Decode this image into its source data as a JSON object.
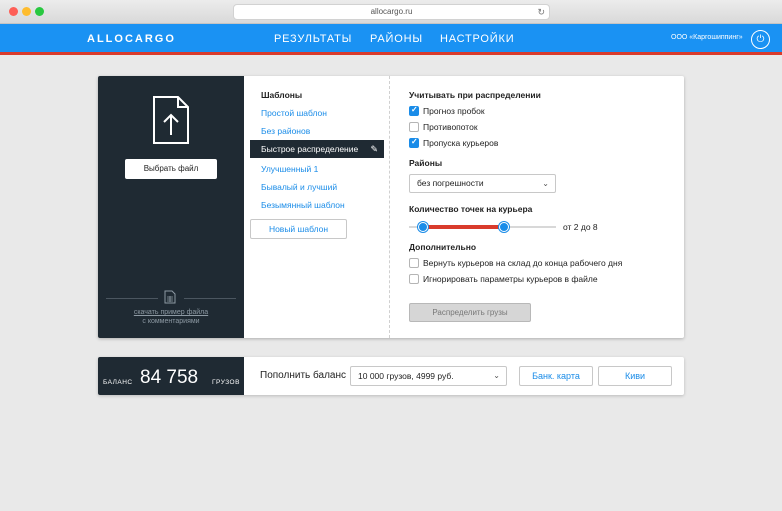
{
  "browser": {
    "url": "allocargo.ru"
  },
  "header": {
    "logo": "ALLOCARGO",
    "nav": [
      "РЕЗУЛЬТАТЫ",
      "РАЙОНЫ",
      "НАСТРОЙКИ"
    ],
    "company": "ООО «Каргошиппинг»"
  },
  "upload": {
    "choose_button": "Выбрать файл",
    "sample_link": "скачать пример файла",
    "sample_sub": "с комментариями"
  },
  "templates": {
    "title": "Шаблоны",
    "items": [
      "Простой шаблон",
      "Без районов",
      "Быстрое распределение",
      "Улучшенный 1",
      "Бывалый и лучший",
      "Безымянный шаблон"
    ],
    "active": "Быстрое распределение",
    "new_button": "Новый шаблон"
  },
  "settings": {
    "consider_title": "Учитывать при распределении",
    "consider": [
      {
        "label": "Прогноз пробок",
        "checked": true
      },
      {
        "label": "Противопоток",
        "checked": false
      },
      {
        "label": "Пропуска курьеров",
        "checked": true
      }
    ],
    "districts_title": "Районы",
    "districts_value": "без погрешности",
    "points_title": "Количество точек на курьера",
    "points_range": "от 2 до 8",
    "additional_title": "Дополнительно",
    "additional": [
      {
        "label": "Вернуть курьеров на склад до конца рабочего дня",
        "checked": false
      },
      {
        "label": "Игнорировать параметры курьеров в файле",
        "checked": false
      }
    ],
    "distribute_button": "Распределить грузы"
  },
  "balance": {
    "label": "БАЛАНС",
    "amount": "84 758",
    "unit": "ГРУЗОВ",
    "topup_label": "Пополнить баланс",
    "topup_value": "10 000 грузов, 4999 руб.",
    "bank_card": "Банк. карта",
    "qiwi": "Киви"
  },
  "colors": {
    "accent": "#1a92f3",
    "accent_line": "#d93b2c",
    "dark_panel": "#1f2a33",
    "link": "#1a8ce8"
  }
}
